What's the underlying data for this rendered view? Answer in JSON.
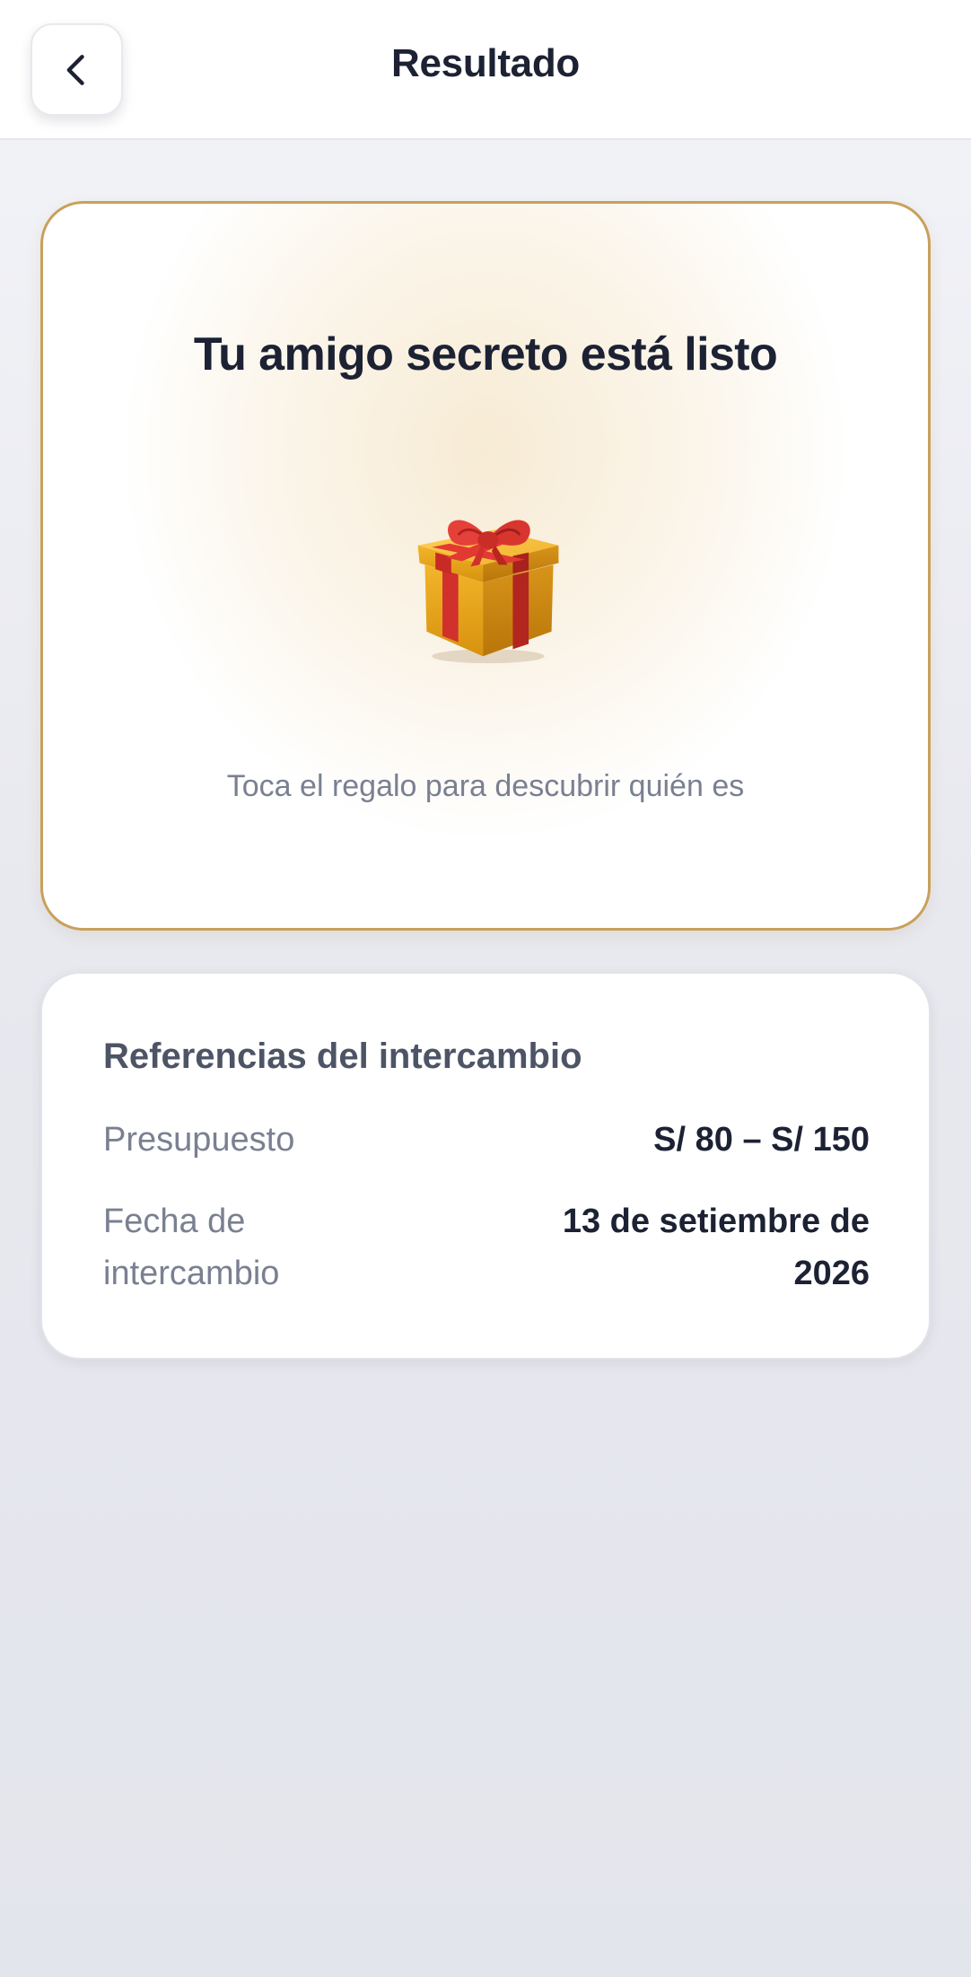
{
  "header": {
    "title": "Resultado",
    "back_icon": "chevron-left-icon"
  },
  "reveal": {
    "title": "Tu amigo secreto está listo",
    "gift_icon": "gift-icon",
    "hint": "Toca el regalo para descubrir quién es"
  },
  "references": {
    "title": "Referencias del intercambio",
    "rows": [
      {
        "label": "Presupuesto",
        "value": "S/ 80 – S/ 150"
      },
      {
        "label": "Fecha de intercambio",
        "value": "13 de setiembre de 2026"
      }
    ]
  },
  "colors": {
    "accent_border": "#c9a05a",
    "gift_box": "#e3a51a",
    "gift_ribbon": "#d1302c",
    "text_primary": "#1c2233",
    "text_muted": "#7a8091"
  }
}
